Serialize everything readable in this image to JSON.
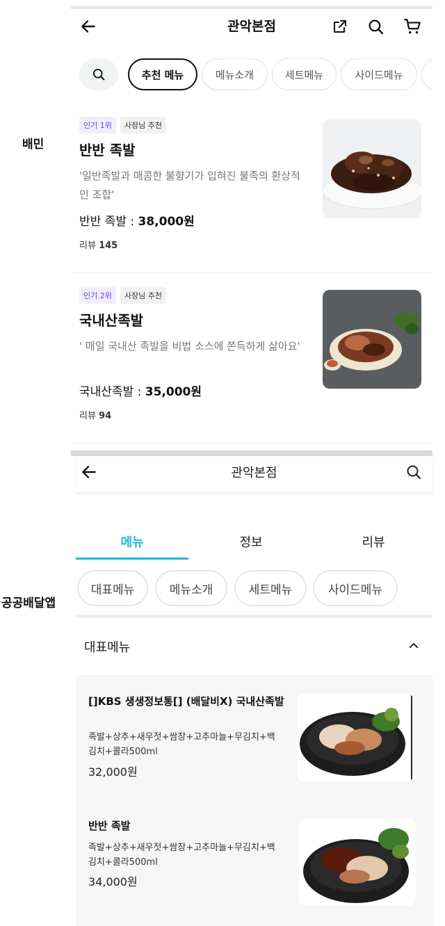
{
  "labels": {
    "top_app": "배민",
    "bottom_app": "공공배달앱"
  },
  "baemin": {
    "store_title": "관악본점",
    "header_icons": [
      "back-arrow-icon",
      "share-icon",
      "search-icon",
      "cart-icon"
    ],
    "chips": [
      "추천 메뉴",
      "메뉴소개",
      "세트메뉴",
      "사이드메뉴"
    ],
    "items": [
      {
        "badge_rank": "인기 1위",
        "badge_owner": "사장님 추천",
        "name": "반반 족발",
        "desc": "'일반족발과 매콤한 불향기가 입혀진 불족의 환상적인 조합'",
        "price_label": "반반 족발 :",
        "price_value": "38,000원",
        "reviews_label": "리뷰",
        "reviews_count": "145"
      },
      {
        "badge_rank": "인기 2위",
        "badge_owner": "사장님 추천",
        "name": "국내산족발",
        "desc": "' 매일 국내산 족발을 비법 소스에 쫀득하게 삶아요'",
        "price_label": "국내산족발 :",
        "price_value": "35,000원",
        "reviews_label": "리뷰",
        "reviews_count": "94"
      }
    ]
  },
  "public_app": {
    "store_title": "관악본점",
    "tabs": [
      "메뉴",
      "정보",
      "리뷰"
    ],
    "active_tab": "메뉴",
    "chips": [
      "대표메뉴",
      "메뉴소개",
      "세트메뉴",
      "사이드메뉴"
    ],
    "section_title": "대표메뉴",
    "items": [
      {
        "name": "[]KBS 생생정보통[] (배달비X) 국내산족발",
        "desc": "족발+상추+새우젓+쌈장+고추마늘+무김치+백김치+콜라500ml",
        "price": "32,000원"
      },
      {
        "name": "반반 족발",
        "desc": "족발+상추+새우젓+쌈장+고추마늘+무김치+백김치+콜라500ml",
        "price": "34,000원"
      }
    ]
  },
  "colors": {
    "accent_public": "#21b7d8",
    "rank_purple": "#6a3de8"
  }
}
